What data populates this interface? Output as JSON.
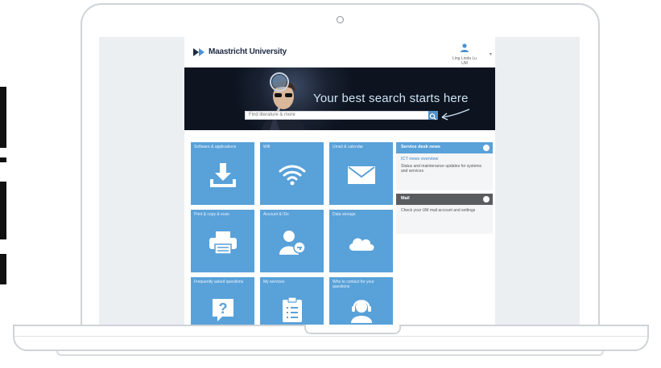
{
  "site": {
    "logo_text": "Maastricht University",
    "account_label_line1": "Ling Linda Lu",
    "account_label_line2": "UM"
  },
  "hero": {
    "headline": "Your best search starts here",
    "search_placeholder": "Find literature & more"
  },
  "tiles": [
    {
      "label": "Software & applications",
      "icon": "download-icon"
    },
    {
      "label": "Wifi",
      "icon": "wifi-icon"
    },
    {
      "label": "Umail & calendar",
      "icon": "mail-icon"
    },
    {
      "label": "Print & copy & scan",
      "icon": "printer-icon"
    },
    {
      "label": "Account & IDs",
      "icon": "user-key-icon"
    },
    {
      "label": "Data storage",
      "icon": "cloud-icon"
    },
    {
      "label": "Frequently asked questions",
      "icon": "question-icon"
    },
    {
      "label": "My services",
      "icon": "clipboard-list-icon"
    },
    {
      "label": "Who to contact for your questions",
      "icon": "support-agent-icon"
    }
  ],
  "side_panels": [
    {
      "title": "Service desk news",
      "link": "ICT news overview",
      "text": "Status and maintenance updates for systems and services",
      "color": "#59a1d9"
    },
    {
      "title": "Mail",
      "link": "",
      "text": "Check your UM mail account and settings",
      "color": "#5a5d60"
    }
  ],
  "colors": {
    "tile_blue": "#59a1d9",
    "hero_bg": "#0d1420",
    "panel_grey": "#5a5d60"
  }
}
